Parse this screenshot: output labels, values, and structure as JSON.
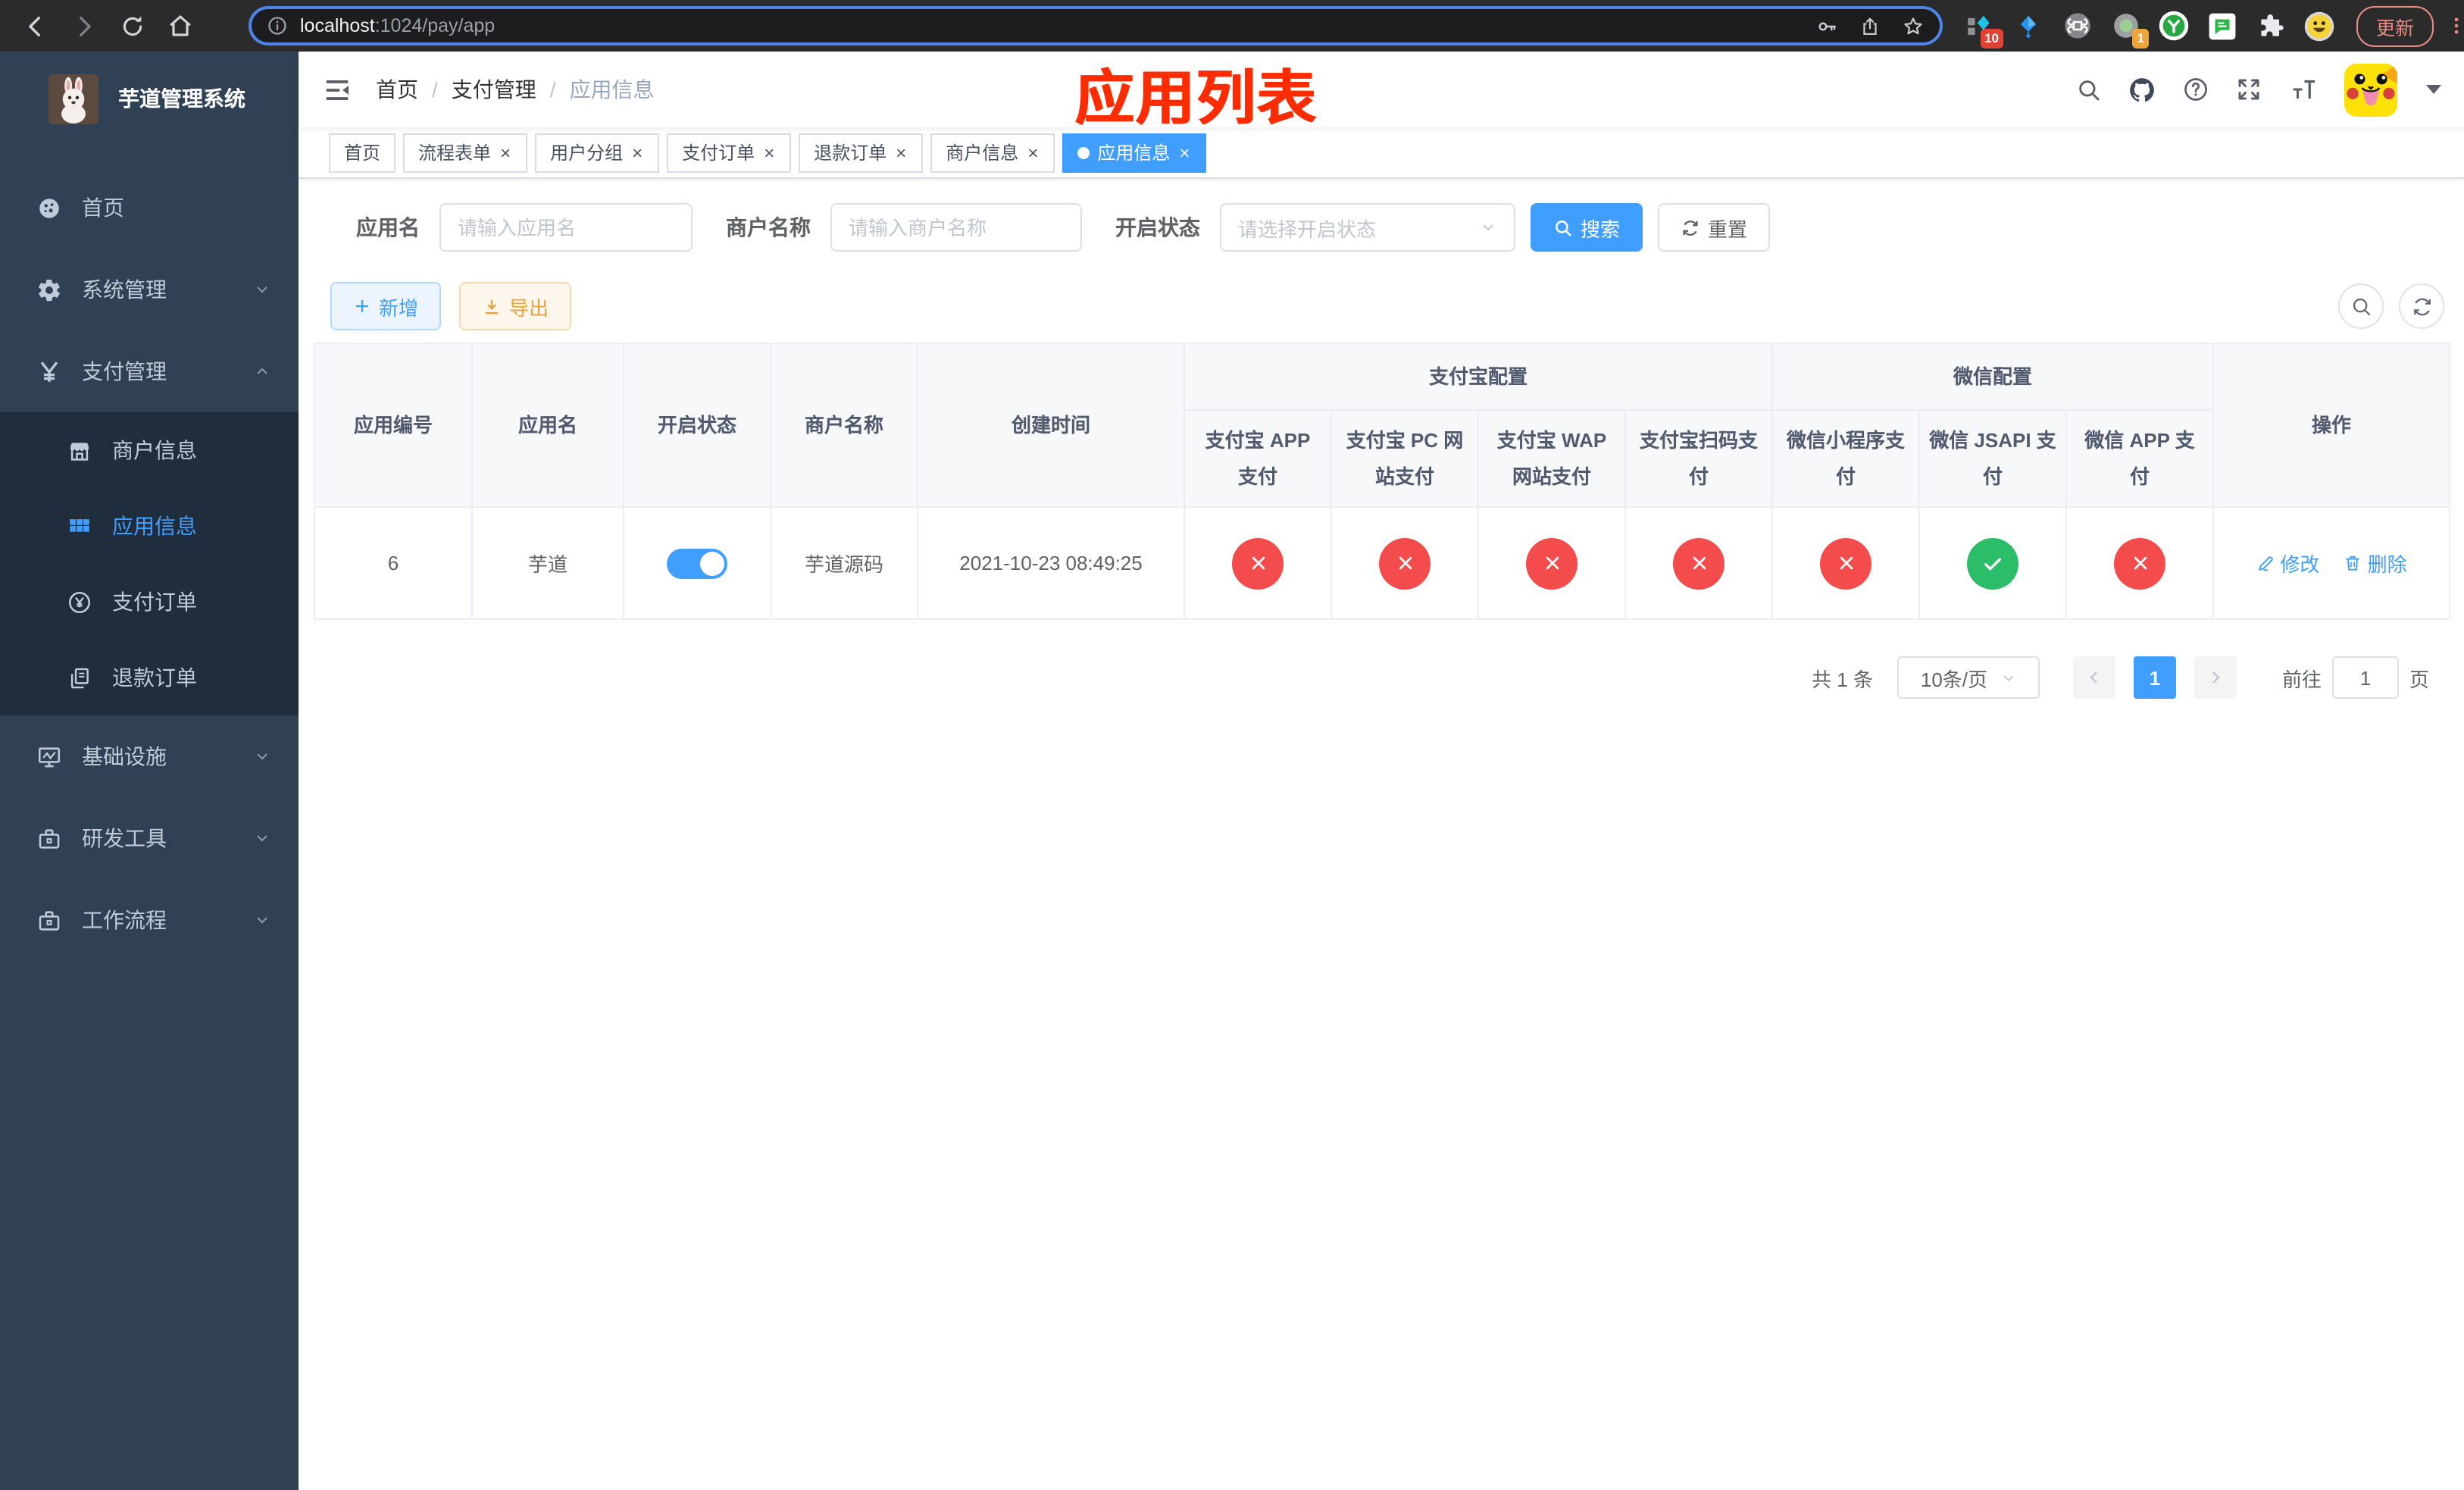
{
  "browser": {
    "url": {
      "host": "localhost",
      "path": ":1024/pay/app"
    },
    "update_label": "更新",
    "ext_badges": {
      "ten": "10",
      "one": "1"
    }
  },
  "sidebar": {
    "app_title": "芋道管理系统",
    "menu": [
      {
        "label": "首页"
      },
      {
        "label": "系统管理"
      },
      {
        "label": "支付管理"
      },
      {
        "label": "商户信息"
      },
      {
        "label": "应用信息"
      },
      {
        "label": "支付订单"
      },
      {
        "label": "退款订单"
      },
      {
        "label": "基础设施"
      },
      {
        "label": "研发工具"
      },
      {
        "label": "工作流程"
      }
    ]
  },
  "navbar": {
    "breadcrumb": [
      "首页",
      "支付管理",
      "应用信息"
    ],
    "annotation": "应用列表"
  },
  "tabs": [
    {
      "label": "首页",
      "closable": false,
      "active": false
    },
    {
      "label": "流程表单",
      "closable": true,
      "active": false
    },
    {
      "label": "用户分组",
      "closable": true,
      "active": false
    },
    {
      "label": "支付订单",
      "closable": true,
      "active": false
    },
    {
      "label": "退款订单",
      "closable": true,
      "active": false
    },
    {
      "label": "商户信息",
      "closable": true,
      "active": false
    },
    {
      "label": "应用信息",
      "closable": true,
      "active": true
    }
  ],
  "filters": {
    "app_name": {
      "label": "应用名",
      "placeholder": "请输入应用名"
    },
    "merchant_name": {
      "label": "商户名称",
      "placeholder": "请输入商户名称"
    },
    "status": {
      "label": "开启状态",
      "placeholder": "请选择开启状态"
    },
    "search_label": "搜索",
    "reset_label": "重置"
  },
  "toolbar": {
    "add_label": "新增",
    "export_label": "导出"
  },
  "table": {
    "columns": [
      "应用编号",
      "应用名",
      "开启状态",
      "商户名称",
      "创建时间"
    ],
    "groups": [
      {
        "label": "支付宝配置",
        "children": [
          "支付宝 APP 支付",
          "支付宝 PC 网站支付",
          "支付宝 WAP 网站支付",
          "支付宝扫码支付"
        ]
      },
      {
        "label": "微信配置",
        "children": [
          "微信小程序支付",
          "微信 JSAPI 支付",
          "微信 APP 支付"
        ]
      }
    ],
    "action_column": "操作",
    "rows": [
      {
        "id": "6",
        "name": "芋道",
        "enabled": true,
        "merchant": "芋道源码",
        "created_at": "2021-10-23 08:49:25",
        "pay_channels": [
          "disabled",
          "disabled",
          "disabled",
          "disabled",
          "disabled",
          "enabled",
          "disabled"
        ],
        "edit_label": "修改",
        "delete_label": "删除"
      }
    ]
  },
  "pagination": {
    "total_label": "共 1 条",
    "page_size_label": "10条/页",
    "current_page": "1",
    "goto_label": "前往",
    "goto_value": "1",
    "goto_suffix": "页"
  },
  "colors": {
    "primary": "#409eff",
    "success": "#2bbd68",
    "danger": "#f44c4c",
    "warning": "#e6a23c",
    "sidebar_bg": "#304156",
    "submenu_bg": "#1f2d3d",
    "annotation_red": "#fe2c00"
  }
}
